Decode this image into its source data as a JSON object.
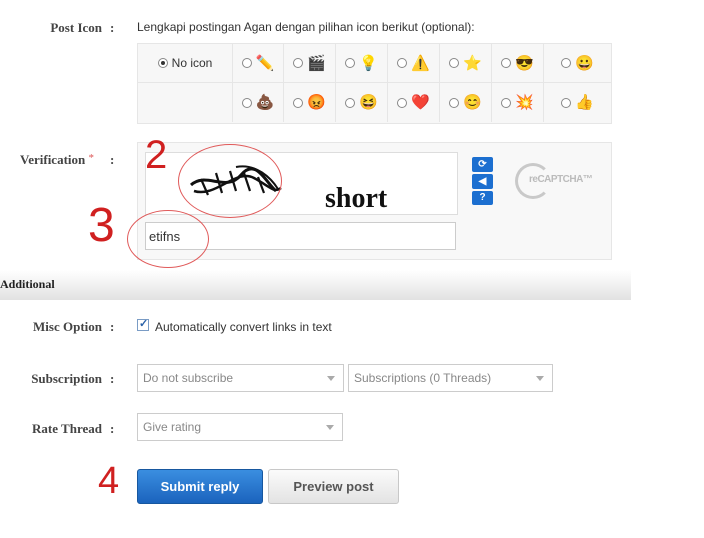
{
  "post_icon": {
    "label": "Post Icon",
    "colon": ":",
    "intro": "Lengkapi postingan Agan dengan pilihan icon berikut (optional):",
    "no_icon_label": "No icon",
    "selected": "No icon",
    "row1_icons": [
      "pencil-icon",
      "clapperboard-icon",
      "lightbulb-icon",
      "warning-icon",
      "star-icon",
      "cool-face-icon",
      "grin-face-icon"
    ],
    "row2_icons": [
      "poop-icon",
      "angry-face-icon",
      "laughing-face-icon",
      "heart-icon",
      "smile-face-icon",
      "red-burst-icon",
      "thumbs-up-icon"
    ]
  },
  "verification": {
    "label": "Verification",
    "required_mark": "*",
    "colon": ":",
    "captcha_word": "short",
    "input_value": "etifns",
    "logo_text": "reCAPTCHA™",
    "controls": [
      "refresh-icon",
      "audio-icon",
      "help-icon"
    ]
  },
  "annotations": [
    "2",
    "3",
    "4"
  ],
  "additional": {
    "section_title": "Additional",
    "misc_option": {
      "label": "Misc Option",
      "colon": ":",
      "checkbox_label": "Automatically convert links in text",
      "checked": true
    },
    "subscription": {
      "label": "Subscription",
      "colon": ":",
      "select_value": "Do not subscribe",
      "folder_value": "Subscriptions (0 Threads)"
    },
    "rate_thread": {
      "label": "Rate Thread",
      "colon": ":",
      "select_value": "Give rating"
    }
  },
  "buttons": {
    "submit": "Submit reply",
    "preview": "Preview post"
  },
  "colors": {
    "primary_button": "#1b63bd",
    "annotation_red": "#d02020"
  }
}
